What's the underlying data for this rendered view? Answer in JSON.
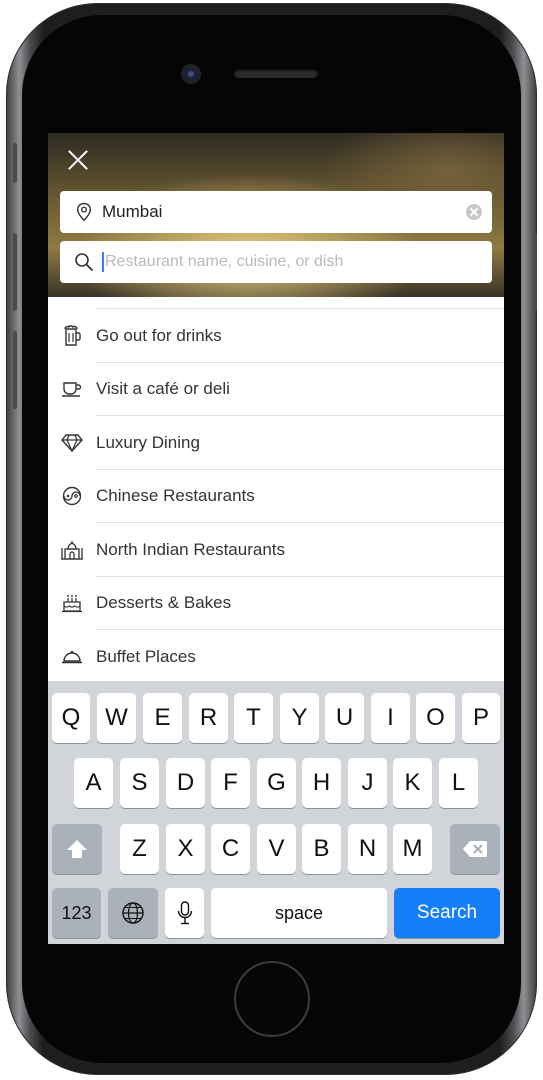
{
  "search": {
    "location_value": "Mumbai",
    "query_placeholder": "Restaurant name, cuisine, or dish"
  },
  "suggestions": [
    {
      "label": "Go out for drinks",
      "icon": "beer-mug-icon"
    },
    {
      "label": "Visit a café or deli",
      "icon": "coffee-cup-icon"
    },
    {
      "label": "Luxury Dining",
      "icon": "diamond-icon"
    },
    {
      "label": "Chinese Restaurants",
      "icon": "yin-yang-icon"
    },
    {
      "label": "North Indian Restaurants",
      "icon": "taj-mahal-icon"
    },
    {
      "label": "Desserts & Bakes",
      "icon": "cake-icon"
    },
    {
      "label": "Buffet Places",
      "icon": "cloche-icon"
    }
  ],
  "keyboard": {
    "row1": [
      "Q",
      "W",
      "E",
      "R",
      "T",
      "Y",
      "U",
      "I",
      "O",
      "P"
    ],
    "row2": [
      "A",
      "S",
      "D",
      "F",
      "G",
      "H",
      "J",
      "K",
      "L"
    ],
    "row3": [
      "Z",
      "X",
      "C",
      "V",
      "B",
      "N",
      "M"
    ],
    "numbers_label": "123",
    "space_label": "space",
    "search_label": "Search"
  },
  "colors": {
    "accent_blue": "#147efb",
    "keyboard_bg": "#d1d4d9"
  }
}
